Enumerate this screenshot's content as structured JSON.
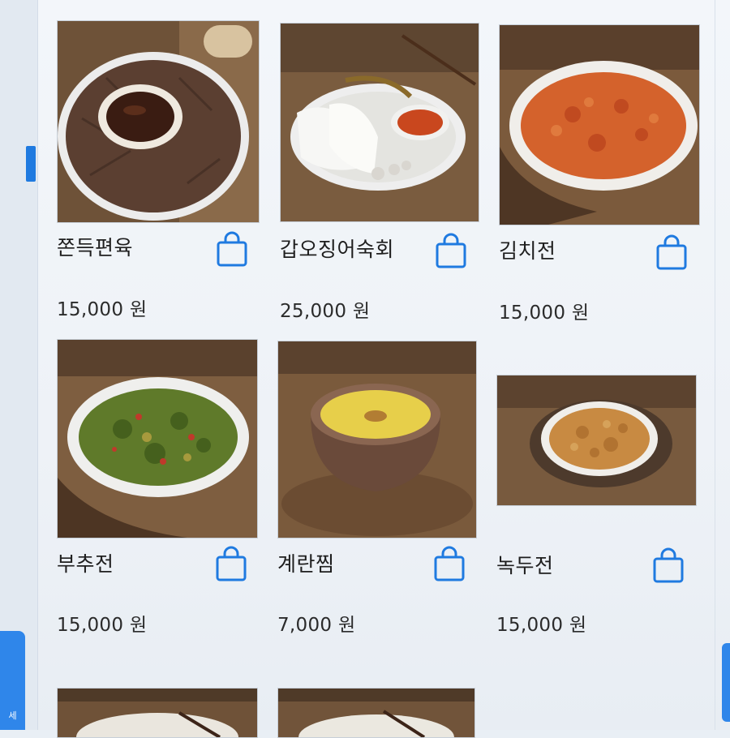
{
  "side_tab": {
    "label": "세"
  },
  "menu": {
    "items": [
      {
        "name": "쫀득편육",
        "price": "15,000 원",
        "photo": "편육 plate with dipping sauce"
      },
      {
        "name": "갑오징어숙회",
        "price": "25,000 원",
        "photo": "squid sashimi with red sauce"
      },
      {
        "name": "김치전",
        "price": "15,000 원",
        "photo": "kimchi pancake"
      },
      {
        "name": "부추전",
        "price": "15,000 원",
        "photo": "chive pancake"
      },
      {
        "name": "계란찜",
        "price": "7,000 원",
        "photo": "steamed egg in earthen pot"
      },
      {
        "name": "녹두전",
        "price": "15,000 원",
        "photo": "mung bean pancake"
      }
    ]
  },
  "icons": {
    "cart": "shopping-bag-icon"
  },
  "colors": {
    "accent": "#1f7ae0",
    "background": "#eef2f7"
  }
}
